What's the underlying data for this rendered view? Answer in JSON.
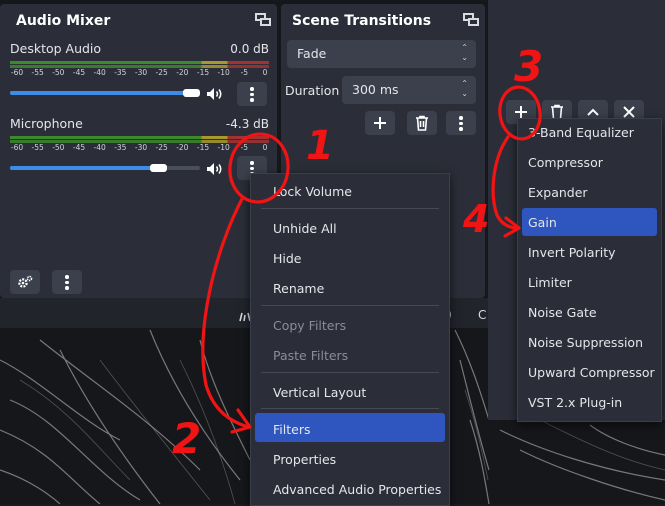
{
  "audio_mixer": {
    "title": "Audio Mixer",
    "channels": [
      {
        "name": "Desktop Audio",
        "db": "0.0 dB",
        "volume": 1.0
      },
      {
        "name": "Microphone",
        "db": "-4.3 dB",
        "volume": 0.86
      }
    ],
    "ticks": [
      "-60",
      "-55",
      "-50",
      "-45",
      "-40",
      "-35",
      "-30",
      "-25",
      "-20",
      "-15",
      "-10",
      "-5",
      "0"
    ]
  },
  "scene_transitions": {
    "title": "Scene Transitions",
    "transition": "Fade",
    "duration_label": "Duration",
    "duration_value": "300 ms"
  },
  "context_menu": {
    "items": [
      {
        "label": "Lock Volume",
        "disabled": false
      },
      {
        "label": "Unhide All",
        "disabled": false
      },
      {
        "label": "Hide",
        "disabled": false
      },
      {
        "label": "Rename",
        "disabled": false
      },
      {
        "label": "Copy Filters",
        "disabled": true
      },
      {
        "label": "Paste Filters",
        "disabled": true
      },
      {
        "label": "Vertical Layout",
        "disabled": false
      },
      {
        "label": "Filters",
        "disabled": false,
        "highlighted": true
      },
      {
        "label": "Properties",
        "disabled": false
      },
      {
        "label": "Advanced Audio Properties",
        "disabled": false
      }
    ]
  },
  "filter_menu": {
    "items": [
      {
        "label": "3-Band Equalizer"
      },
      {
        "label": "Compressor"
      },
      {
        "label": "Expander"
      },
      {
        "label": "Gain",
        "highlighted": true
      },
      {
        "label": "Invert Polarity"
      },
      {
        "label": "Limiter"
      },
      {
        "label": "Noise Gate"
      },
      {
        "label": "Noise Suppression"
      },
      {
        "label": "Upward Compressor"
      },
      {
        "label": "VST 2.x Plug-in"
      }
    ]
  },
  "status_fragments": {
    "frag1": "0",
    "frag2": "C"
  },
  "annotations": {
    "n1": "1",
    "n2": "2",
    "n3": "3",
    "n4": "4"
  },
  "colors": {
    "accent": "#2f55be",
    "slider": "#3d8de6",
    "meter_green": "#4caf3c",
    "meter_yellow": "#c9b432",
    "meter_red": "#d23c3c",
    "annotation": "#f11414"
  }
}
